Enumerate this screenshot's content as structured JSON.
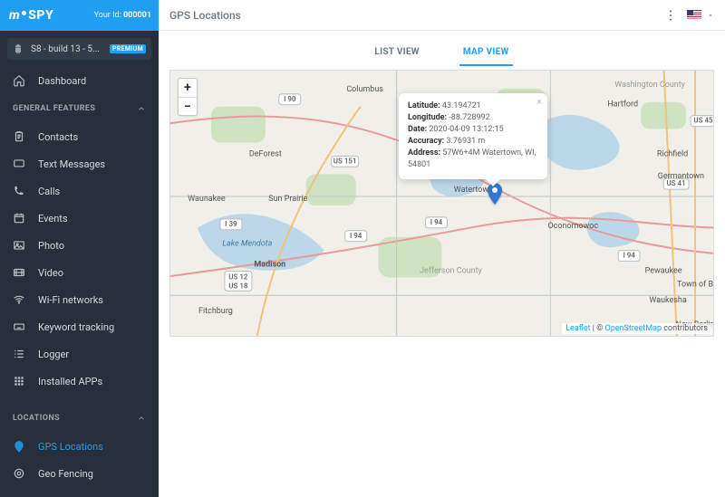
{
  "brand": {
    "name": "mSPY"
  },
  "user": {
    "id_label": "Your Id:",
    "id_value": "000001"
  },
  "device": {
    "label": "S8 - build 13 - 5...",
    "badge": "PREMIUM"
  },
  "nav": {
    "dashboard": "Dashboard",
    "section_general": "GENERAL FEATURES",
    "items_general": {
      "contacts": "Contacts",
      "text_messages": "Text Messages",
      "calls": "Calls",
      "events": "Events",
      "photo": "Photo",
      "video": "Video",
      "wifi": "Wi-Fi networks",
      "keyword": "Keyword tracking",
      "logger": "Logger",
      "installed_apps": "Installed APPs"
    },
    "section_locations": "LOCATIONS",
    "items_locations": {
      "gps": "GPS Locations",
      "geofencing": "Geo Fencing"
    }
  },
  "page": {
    "title": "GPS Locations"
  },
  "tabs": {
    "list": "LIST VIEW",
    "map": "MAP VIEW"
  },
  "zoom": {
    "in": "+",
    "out": "−"
  },
  "popup": {
    "lat_label": "Latitude:",
    "lat_value": "43.194721",
    "lon_label": "Longitude:",
    "lon_value": "-88.728992",
    "date_label": "Date:",
    "date_value": "2020-04-09 13:12:15",
    "acc_label": "Accuracy:",
    "acc_value": "3.76931 m",
    "addr_label": "Address:",
    "addr_value": "57W6+4M Watertown, WI, 54801"
  },
  "map_labels": {
    "cities": {
      "columbus": "Columbus",
      "deforest": "DeForest",
      "waunakee": "Waunakee",
      "sunprairie": "Sun Prairie",
      "lakemendota": "Lake Mendota",
      "madison": "Madison",
      "fitchburg": "Fitchburg",
      "watertown": "Watertown",
      "jeffersonco": "Jefferson County",
      "oconomowoc": "Oconomowoc",
      "pewaukee": "Pewaukee",
      "waukesha": "Waukesha",
      "newberlin": "New Berlin",
      "brookfield": "Town of Brookfield",
      "washingtonco": "Washington County",
      "hartford": "Hartford",
      "richfield": "Richfield",
      "germantown": "Germantown"
    },
    "routes": {
      "i90": "I 90",
      "i94": "I 94",
      "i39": "I 39",
      "us151": "US 151",
      "us12_18": "US 12\nUS 18",
      "us41": "US 41",
      "us45": "US 45"
    }
  },
  "attribution": {
    "leaflet": "Leaflet",
    "sep": " | © ",
    "osm": "OpenStreetMap",
    "tail": " contributors"
  }
}
